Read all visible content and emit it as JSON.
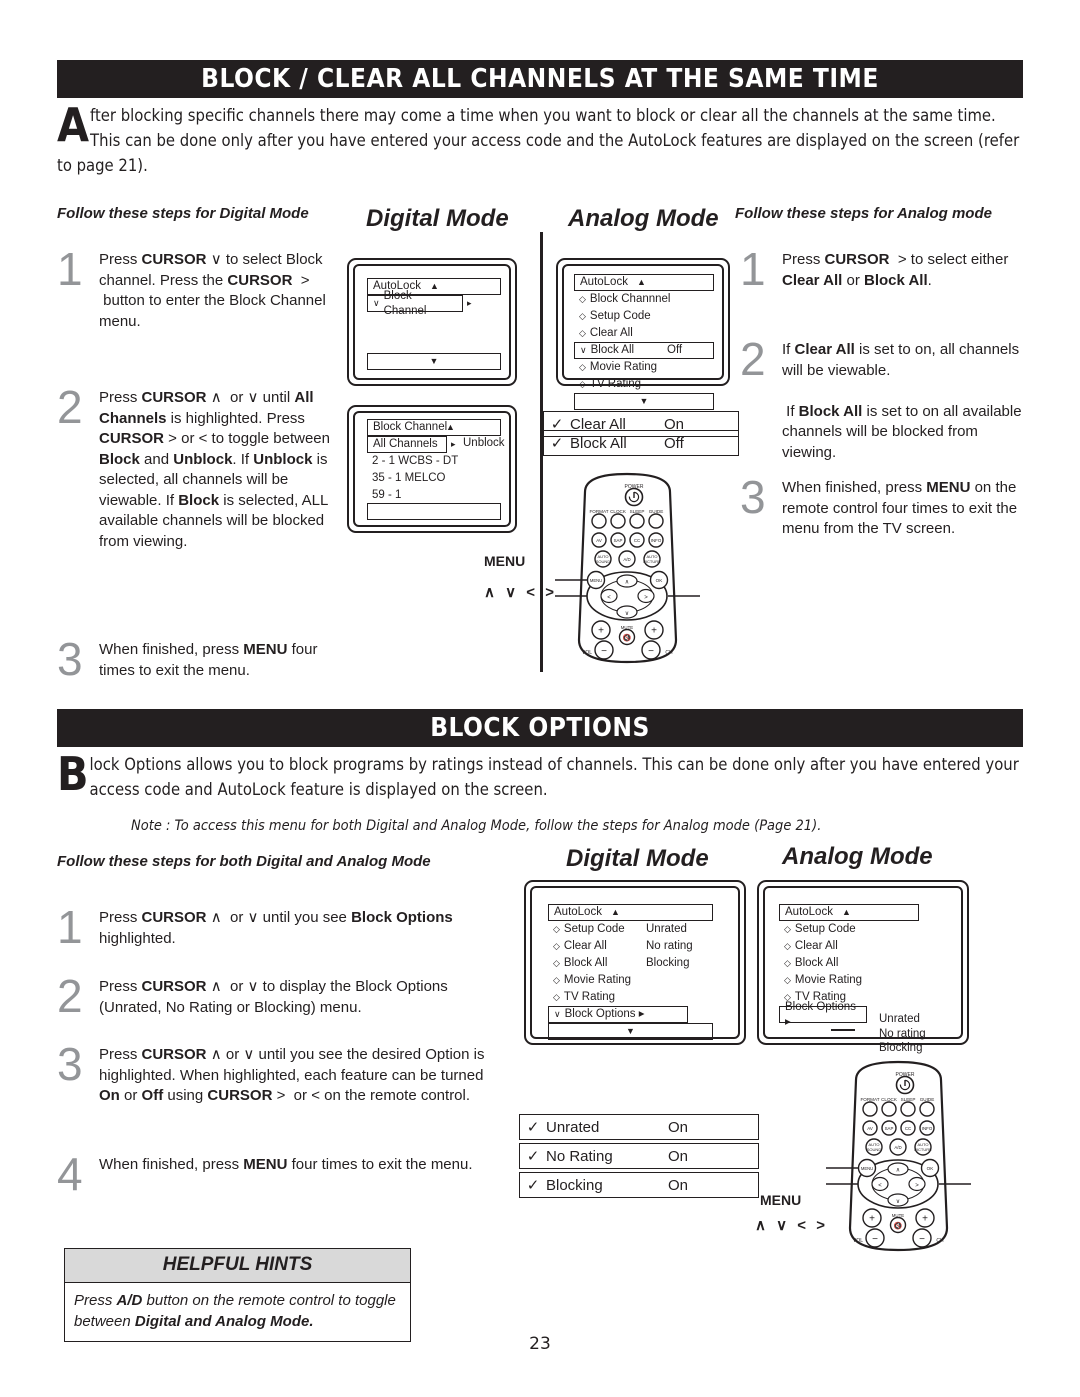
{
  "page_number": "23",
  "colors": {
    "banner_bg": "#231f20",
    "step_number": "#939598",
    "hint_header_bg": "#d9d9d9"
  },
  "section1": {
    "banner_title": "BLOCK / CLEAR ALL CHANNELS AT THE SAME TIME",
    "dropcap": "A",
    "intro": "fter blocking specific channels there may come a time when you want to block or clear all the channels at the same time.  This can be done only after you have entered your access code and the AutoLock features are displayed on the screen (refer to page 21).",
    "left_heading": "Follow these steps for Digital Mode",
    "right_heading": "Follow these steps for Analog mode",
    "digital_caption": "Digital Mode",
    "analog_caption": "Analog Mode",
    "left_steps": [
      {
        "num": "1",
        "html": "Press <b>CURSOR</b> &or; to select Block channel. Press the <b>CURSOR</b> &nbsp;&gt; &nbsp;button to enter the Block Channel menu."
      },
      {
        "num": "2",
        "html": "Press <b>CURSOR</b> &and; &nbsp;or &or; until <b>All Channels</b> is highlighted.  Press <b>CURSOR</b> &gt; or &lt; to toggle between <b>Block</b> and <b>Unblock</b>.  If <b>Unblock</b> is selected, all channels will be viewable.   If <b>Block</b> is selected,  ALL available channels will be blocked from viewing."
      },
      {
        "num": "3",
        "html": "When finished, press <b>MENU</b> four times to exit the menu."
      }
    ],
    "right_steps": [
      {
        "num": "1",
        "html": "Press <b>CURSOR</b> &nbsp;&gt; to select either <b>Clear All</b> or <b>Block All</b>."
      },
      {
        "num": "2",
        "html": "If <b>Clear All</b> is set to on, all channels will be viewable.<br><br>&nbsp;If <b>Block All</b> is set to on all available channels will be blocked from viewing."
      },
      {
        "num": "3",
        "html": "When finished, press <b>MENU</b> on the remote control four times to exit the menu from the TV screen."
      }
    ],
    "digital_screen_1": {
      "title": "AutoLock",
      "title_caret": "▲",
      "highlight": {
        "check": "∨",
        "label": "Block Channel",
        "arrow": "▸"
      },
      "bottom_caret": "▼"
    },
    "digital_screen_2": {
      "title": "Block Channel",
      "title_caret": "▲",
      "highlight": {
        "label": "All Channels",
        "arrow": "▸",
        "value": "Unblock"
      },
      "channels": [
        "2   - 1 WCBS - DT",
        "35 - 1 MELCO",
        "59 - 1"
      ]
    },
    "analog_screen_1": {
      "title": "AutoLock",
      "title_caret": "▲",
      "items": [
        {
          "bullet": "◇",
          "label": "Block Channnel",
          "value": ""
        },
        {
          "bullet": "◇",
          "label": "Setup Code",
          "value": ""
        },
        {
          "bullet": "◇",
          "label": "Clear All",
          "value": ""
        },
        {
          "bullet": "∨",
          "label": "Block All",
          "value": "Off",
          "highlight": true
        },
        {
          "bullet": "◇",
          "label": "Movie Rating",
          "value": ""
        },
        {
          "bullet": "◇",
          "label": "TV Rating",
          "value": ""
        }
      ],
      "bottom_caret": "▼"
    },
    "analog_option_bars": [
      {
        "check": "✓",
        "label": "Clear All",
        "value": "On"
      },
      {
        "check": "✓",
        "label": "Block All",
        "value": "Off"
      }
    ]
  },
  "section2": {
    "banner_title": "BLOCK OPTIONS",
    "dropcap": "B",
    "intro": "lock Options allows you to block programs by ratings instead of channels.   This can be done only after you have entered your access code and AutoLock feature is displayed on the screen.",
    "note": "Note : To access this menu for both Digital and Analog Mode, follow the steps for Analog mode (Page 21).",
    "left_heading": "Follow these steps for both Digital and Analog Mode",
    "digital_caption": "Digital Mode",
    "analog_caption": "Analog Mode",
    "steps": [
      {
        "num": "1",
        "html": "Press <b>CURSOR</b> &and; &nbsp;or &or; until you see <b>Block Options</b> highlighted."
      },
      {
        "num": "2",
        "html": "Press <b>CURSOR</b> &and; &nbsp;or &or; to display the Block Options (Unrated, No Rating or Blocking) menu."
      },
      {
        "num": "3",
        "html": "Press <b>CURSOR</b> &and; or &or; until you see the desired Option is highlighted.  When highlighted, each feature can be turned <b>On</b> or <b>Off</b> using <b>CURSOR</b> &gt; &nbsp;or &lt; on the remote control."
      },
      {
        "num": "4",
        "html": "When finished, press <b>MENU</b> four times to exit the menu."
      }
    ],
    "digital_screen": {
      "title": "AutoLock",
      "title_caret": "▲",
      "items": [
        {
          "bullet": "◇",
          "label": "Setup Code",
          "value": "Unrated"
        },
        {
          "bullet": "◇",
          "label": "Clear All",
          "value": "No rating"
        },
        {
          "bullet": "◇",
          "label": "Block All",
          "value": "Blocking"
        },
        {
          "bullet": "◇",
          "label": "Movie Rating",
          "value": ""
        },
        {
          "bullet": "◇",
          "label": "TV Rating",
          "value": ""
        },
        {
          "bullet": "∨",
          "label": "Block Options ▸",
          "value": "",
          "highlight": true
        }
      ],
      "bottom_caret": "▼"
    },
    "analog_screen": {
      "title": "AutoLock",
      "title_caret": "▲",
      "items": [
        {
          "bullet": "◇",
          "label": "Setup Code",
          "value": ""
        },
        {
          "bullet": "◇",
          "label": "Clear All",
          "value": ""
        },
        {
          "bullet": "◇",
          "label": "Block All",
          "value": ""
        },
        {
          "bullet": "◇",
          "label": "Movie Rating",
          "value": ""
        },
        {
          "bullet": "◇",
          "label": "TV Rating",
          "value": ""
        }
      ],
      "highlight_label": "Block Options ▸",
      "side_values": [
        "Unrated",
        "No rating",
        "Blocking"
      ]
    },
    "option_bars": [
      {
        "check": "✓",
        "label": "Unrated",
        "value": "On"
      },
      {
        "check": "✓",
        "label": "No Rating",
        "value": "On"
      },
      {
        "check": "✓",
        "label": "Blocking",
        "value": "On"
      }
    ]
  },
  "remote": {
    "power_label": "POWER",
    "row1": [
      "FORMAT",
      "CLOCK",
      "SLEEP",
      "GUIDE"
    ],
    "row2": [
      "AV",
      "SAP",
      "CC",
      "INFO"
    ],
    "row3": [
      "AUTO SOUND",
      "A/D",
      "AUTO PICTURE"
    ],
    "menu_button": "MENU",
    "ok_button": "OK",
    "mute_label": "MUTE",
    "vol_label": "VOL",
    "ch_label": "CH",
    "callout_menu": "MENU",
    "callout_cursor": "∧ ∨ < >"
  },
  "hints": {
    "header": "HELPFUL HINTS",
    "body_html": "Press <b>A/D</b> button on the remote control to toggle between <b>Digital and Analog Mode.</b>"
  }
}
